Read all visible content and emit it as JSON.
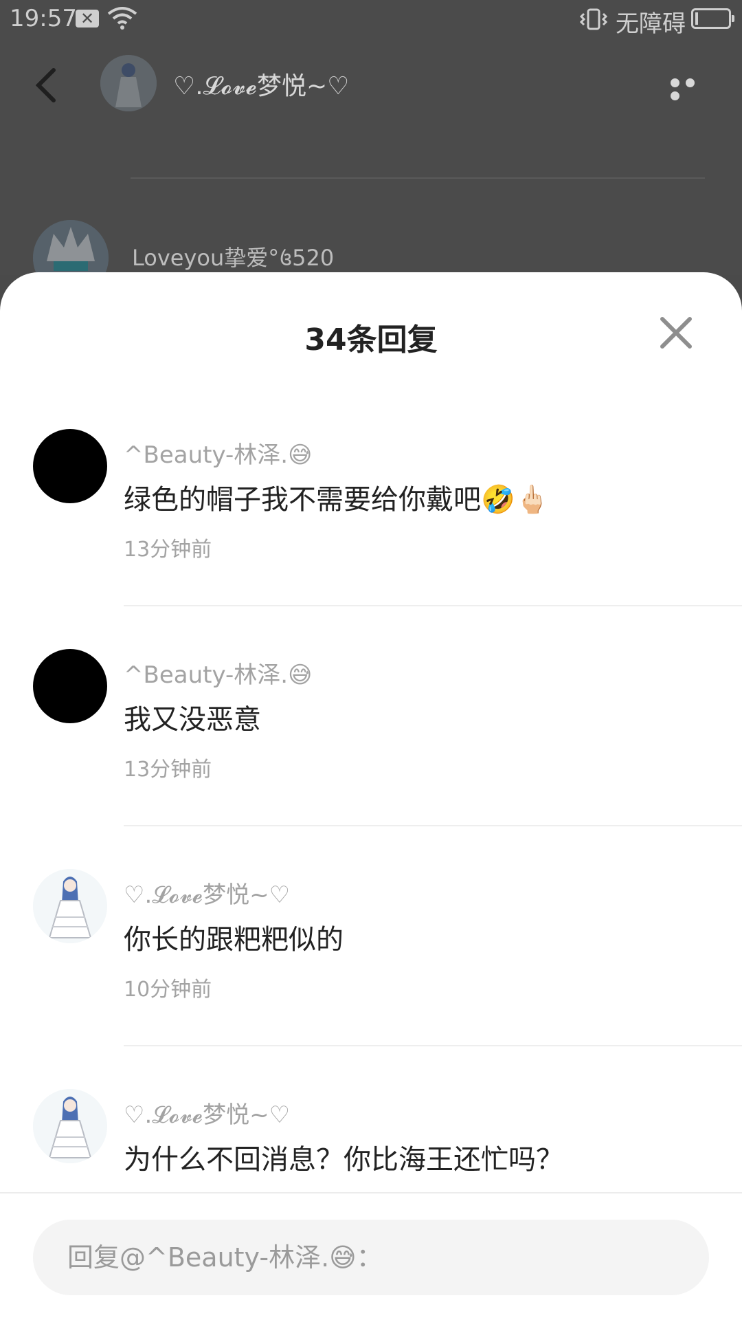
{
  "status_bar": {
    "time": "19:57",
    "notification_icon": "notification-x-icon",
    "wifi_icon": "wifi-icon",
    "vibrate_icon": "vibrate-icon",
    "accessibility_text": "无障碍",
    "battery_icon": "battery-icon"
  },
  "header": {
    "back_icon": "back-chevron-icon",
    "title": "♡.𝓛𝓸𝓿𝓮梦悦~♡",
    "more_icon": "more-dots-icon"
  },
  "background_comment": {
    "author": "Loveyou挚爱°꧔520"
  },
  "sheet": {
    "title": "34条回复",
    "close_icon": "close-icon"
  },
  "comments": [
    {
      "author": "^Beauty-林泽.😅",
      "text": "绿色的帽子我不需要给你戴吧🤣🖕🏻",
      "time": "13分钟前",
      "avatar": "black"
    },
    {
      "author": "^Beauty-林泽.😅",
      "text": "我又没恶意",
      "time": "13分钟前",
      "avatar": "black"
    },
    {
      "author": "♡.𝓛𝓸𝓿𝓮梦悦~♡",
      "text": "你长的跟粑粑似的",
      "time": "10分钟前",
      "avatar": "anime"
    },
    {
      "author": "♡.𝓛𝓸𝓿𝓮梦悦~♡",
      "text": "为什么不回消息？你比海王还忙吗？",
      "time": "",
      "avatar": "anime"
    }
  ],
  "reply": {
    "placeholder": "回复@^Beauty-林泽.😅："
  },
  "colors": {
    "dim_background": "#4b4b4b",
    "sheet_background": "#ffffff",
    "secondary_text": "#a3a3a3",
    "primary_text": "#222222",
    "input_background": "#f4f4f4"
  }
}
